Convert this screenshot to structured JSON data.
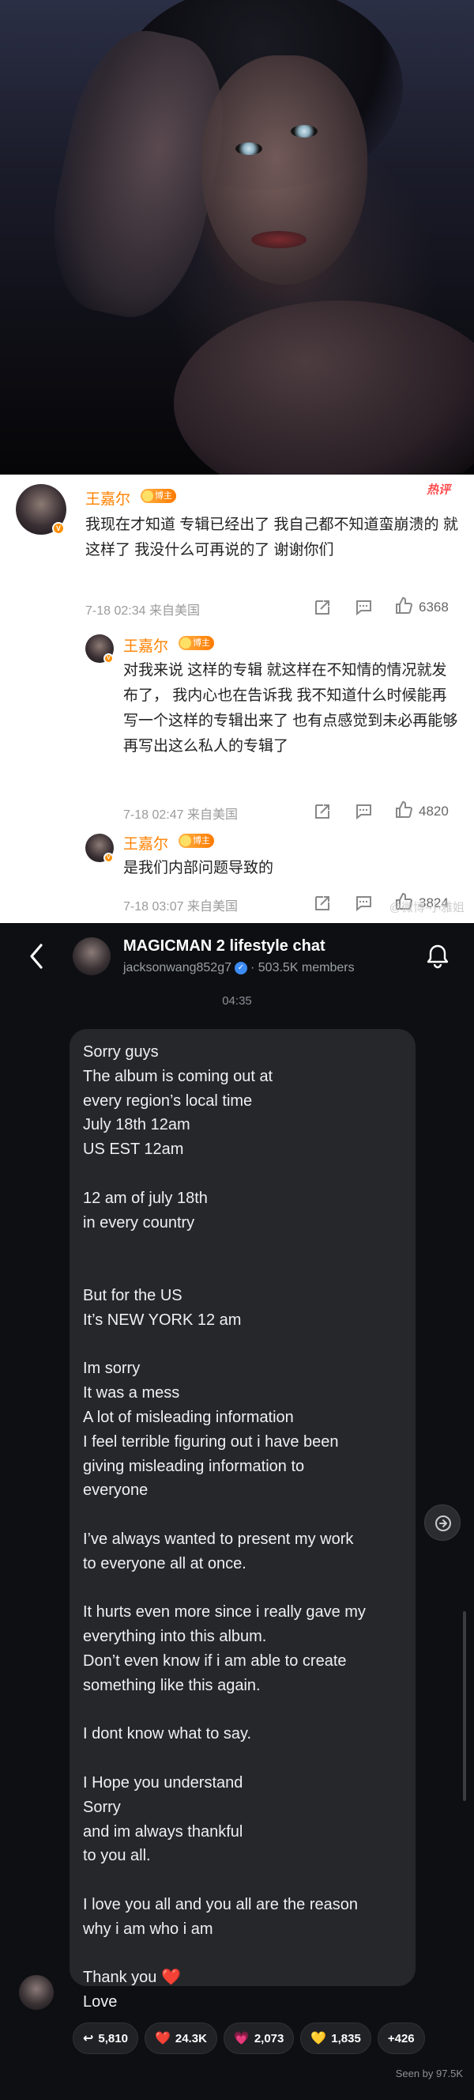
{
  "weibo": {
    "hot_label": "热评",
    "comments": [
      {
        "name": "王嘉尔",
        "tag": "博主",
        "text": "我现在才知道 专辑已经出了 我自己都不知道蛮崩溃的 就这样了 我没什么可再说的了 谢谢你们",
        "meta": "7-18 02:34 来自美国",
        "likes": "6368"
      },
      {
        "name": "王嘉尔",
        "tag": "博主",
        "text": "对我来说 这样的专辑 就这样在不知情的情况就发布了， 我内心也在告诉我 我不知道什么时候能再写一个这样的专辑出来了 也有点感觉到未必再能够再写出这么私人的专辑了",
        "meta": "7-18 02:47 来自美国",
        "likes": "4820"
      },
      {
        "name": "王嘉尔",
        "tag": "博主",
        "text": "是我们内部问题导致的",
        "meta": "7-18 03:07 来自美国",
        "likes": "3824"
      }
    ],
    "watermark": "@微博-小雅姐"
  },
  "chat": {
    "title": "MAGICMAN 2 lifestyle chat",
    "handle": "jacksonwang852g7",
    "members": "· 503.5K members",
    "time": "04:35",
    "message": "Sorry guys\nThe album is coming out at\nevery region’s local time\nJuly 18th 12am\nUS EST 12am\n\n12 am of july 18th\nin every country\n\n\nBut for the US\nIt’s NEW YORK 12 am\n\nIm sorry\nIt was a mess\nA lot of misleading information\nI feel terrible figuring out i have been\ngiving misleading information to\neveryone\n\nI’ve always wanted to present my work\nto everyone all at once.\n\nIt hurts even more since i really gave my\neverything into this album.\nDon’t even know if i am able to create\nsomething like this again.\n\nI dont know what to say.\n\nI Hope you understand\nSorry\nand im always thankful\nto you all.\n\nI love you all and you all are the reason\nwhy i am who i am\n\nThank you ❤️\nLove",
    "reactions": [
      {
        "emoji": "↩",
        "count": "5,810",
        "icon": "forward-icon"
      },
      {
        "emoji": "❤️",
        "count": "24.3K",
        "icon": "red-heart-icon"
      },
      {
        "emoji": "💗",
        "count": "2,073",
        "icon": "pink-heart-icon"
      },
      {
        "emoji": "💛",
        "count": "1,835",
        "icon": "yellow-heart-icon"
      },
      {
        "emoji": "",
        "count": "+426",
        "icon": "more-reactions"
      }
    ],
    "seen": "Seen by 97.5K"
  },
  "colors": {
    "weibo_name": "#ff8200",
    "chat_bg": "#0e0f12",
    "bubble_bg": "#26272b",
    "verified": "#3c8cf5"
  }
}
